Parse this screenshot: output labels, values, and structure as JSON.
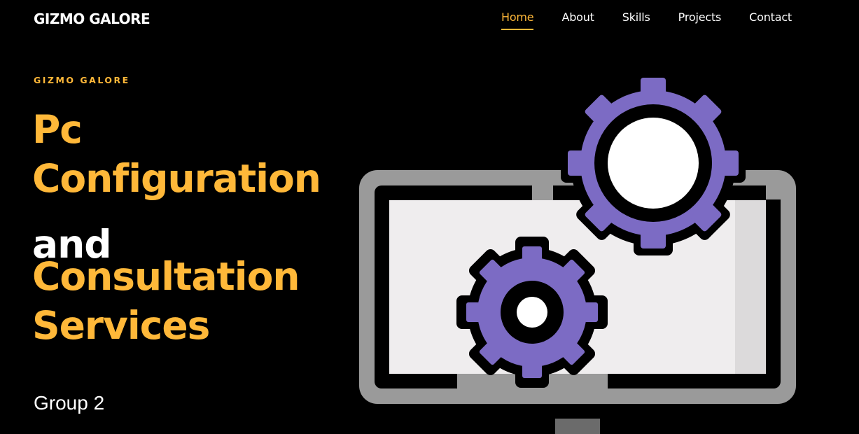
{
  "header": {
    "logo": "GIZMO GALORE",
    "nav": [
      {
        "label": "Home",
        "active": true
      },
      {
        "label": "About",
        "active": false
      },
      {
        "label": "Skills",
        "active": false
      },
      {
        "label": "Projects",
        "active": false
      },
      {
        "label": "Contact",
        "active": false
      }
    ]
  },
  "hero": {
    "eyebrow": "GIZMO GALORE",
    "line1": "Pc",
    "line2": "Configuration",
    "line3": "and",
    "line4": "Consultation",
    "line5": "Services",
    "subtitle": "Group 2",
    "illustration_icon": "monitor-gears-icon"
  },
  "colors": {
    "accent": "#ffb839",
    "background": "#000000",
    "text": "#ffffff",
    "gear": "#7c6bc4"
  }
}
